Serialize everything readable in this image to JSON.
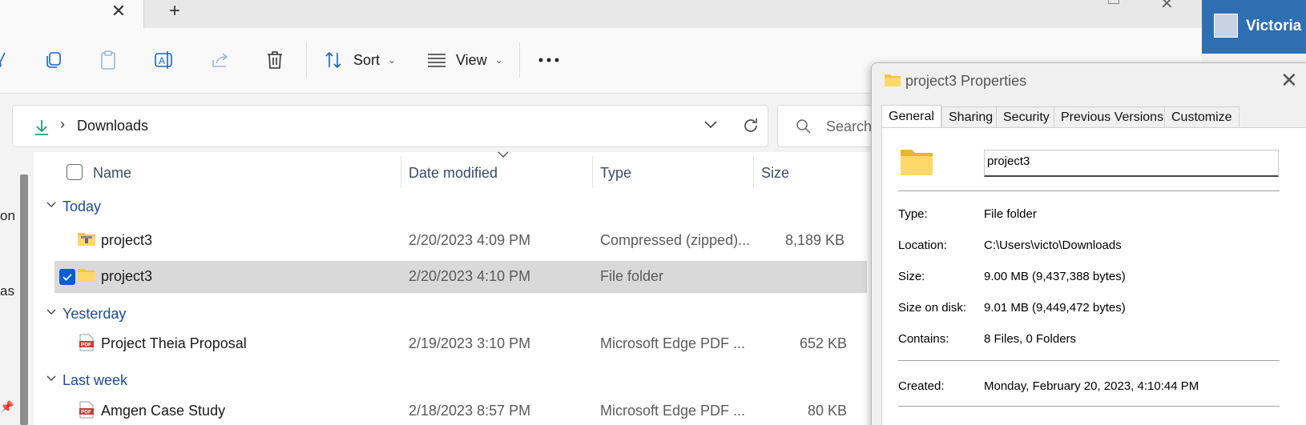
{
  "explorer": {
    "toolbar": {
      "sort_label": "Sort",
      "view_label": "View"
    },
    "address": {
      "current": "Downloads",
      "search_placeholder": "Search D"
    },
    "columns": {
      "name": "Name",
      "date_modified": "Date modified",
      "type": "Type",
      "size": "Size"
    },
    "groups": [
      {
        "label": "Today"
      },
      {
        "label": "Yesterday"
      },
      {
        "label": "Last week"
      }
    ],
    "rows": [
      {
        "name": "project3",
        "date": "2/20/2023 4:09 PM",
        "type": "Compressed (zipped)...",
        "size": "8,189 KB",
        "icon": "zip-folder-icon"
      },
      {
        "name": "project3",
        "date": "2/20/2023 4:10 PM",
        "type": "File folder",
        "size": "",
        "icon": "folder-icon",
        "selected": true
      },
      {
        "name": "Project Theia Proposal",
        "date": "2/19/2023 3:10 PM",
        "type": "Microsoft Edge PDF ...",
        "size": "652 KB",
        "icon": "pdf-icon"
      },
      {
        "name": "Amgen Case Study",
        "date": "2/18/2023 8:57 PM",
        "type": "Microsoft Edge PDF ...",
        "size": "80 KB",
        "icon": "pdf-icon"
      }
    ],
    "nav_fragments": [
      "on",
      "as"
    ]
  },
  "dialog": {
    "title": "project3 Properties",
    "tabs": [
      "General",
      "Sharing",
      "Security",
      "Previous Versions",
      "Customize"
    ],
    "name_value": "project3",
    "props": [
      {
        "label": "Type:",
        "value": "File folder"
      },
      {
        "label": "Location:",
        "value": "C:\\Users\\victo\\Downloads"
      },
      {
        "label": "Size:",
        "value": "9.00 MB (9,437,388 bytes)"
      },
      {
        "label": "Size on disk:",
        "value": "9.01 MB (9,449,472 bytes)"
      },
      {
        "label": "Contains:",
        "value": "8 Files, 0 Folders"
      },
      {
        "label": "Created:",
        "value": "Monday, February 20, 2023, 4:10:44 PM"
      }
    ]
  },
  "user": {
    "name": "Victoria"
  },
  "colors": {
    "accent": "#0b5cd5",
    "group_text": "#1f4a9a",
    "selection": "#d9d9d9",
    "user_bar": "#2e6fb2"
  }
}
